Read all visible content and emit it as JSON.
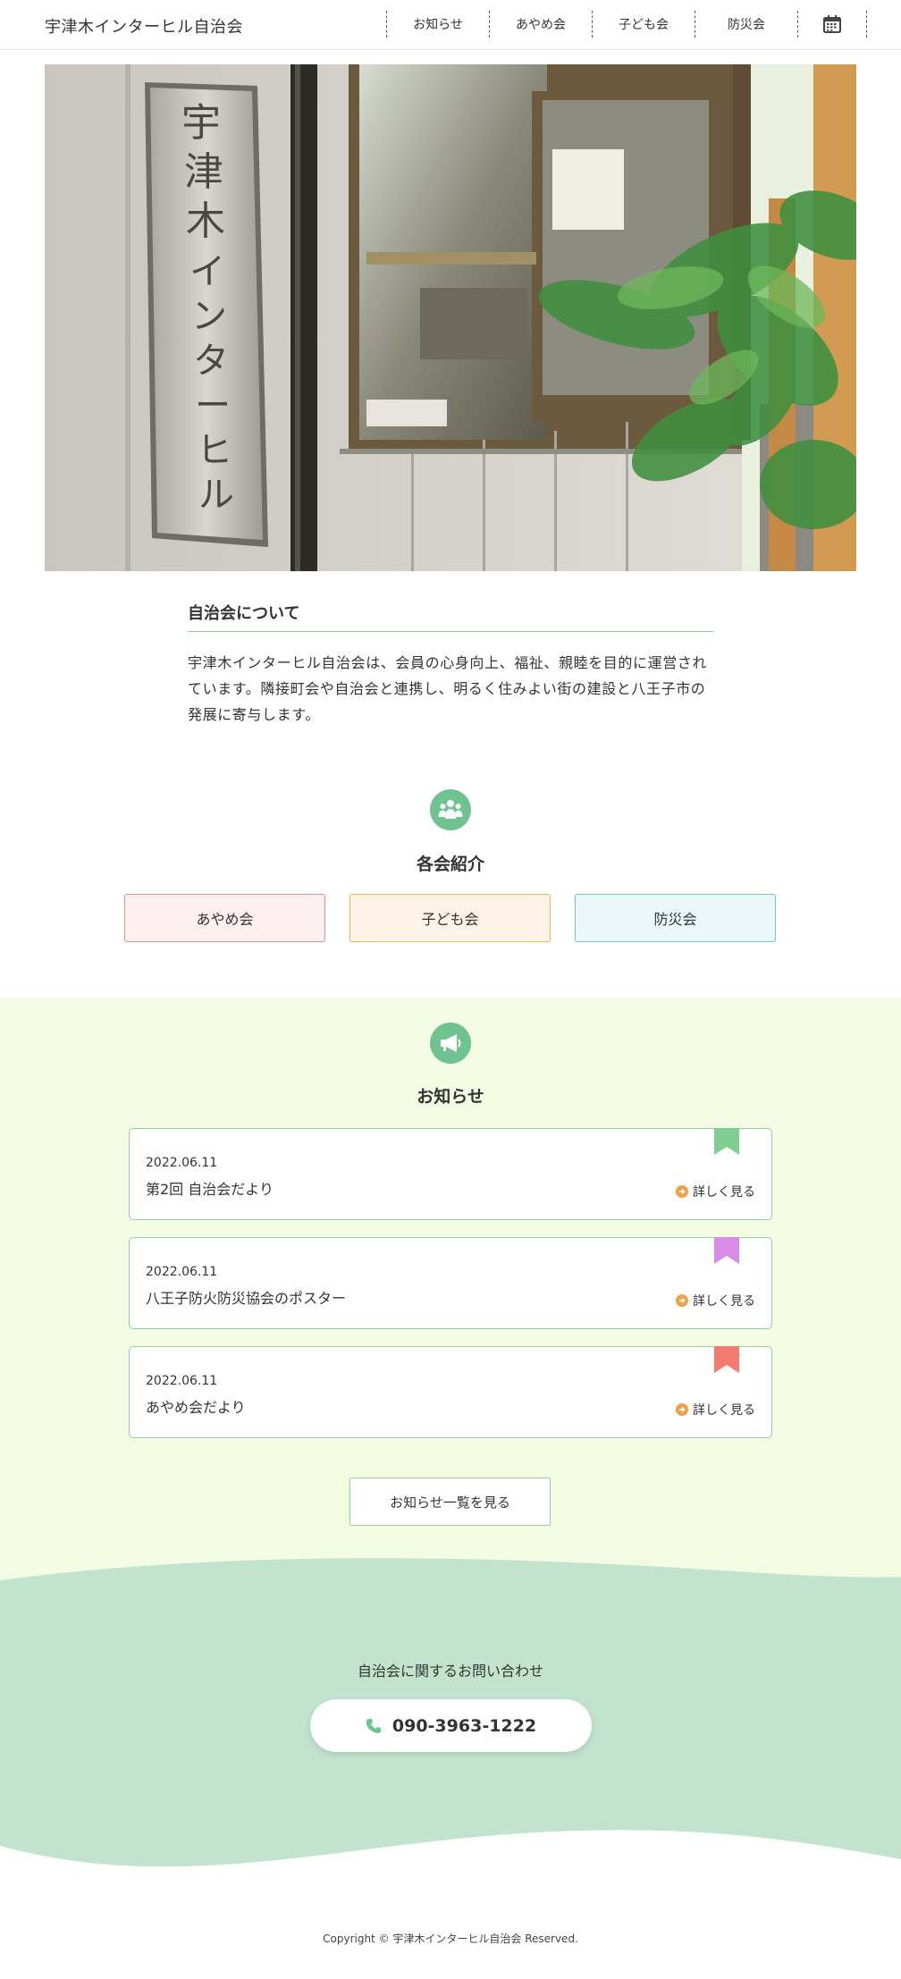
{
  "header": {
    "site_title": "宇津木インターヒル自治会",
    "nav": [
      "お知らせ",
      "あやめ会",
      "子ども会",
      "防災会"
    ],
    "calendar_icon": "calendar-icon"
  },
  "hero": {
    "sign_text": "宇津木インターヒル自治会事務所"
  },
  "about": {
    "title": "自治会について",
    "text": "宇津木インターヒル自治会は、会員の心身向上、福祉、親睦を目的に運営されています。隣接町会や自治会と連携し、明るく住みよい街の建設と八王子市の発展に寄与します。"
  },
  "groups": {
    "icon": "people-icon",
    "title": "各会紹介",
    "items": [
      "あやめ会",
      "子ども会",
      "防災会"
    ]
  },
  "news": {
    "icon": "megaphone-icon",
    "title": "お知らせ",
    "items": [
      {
        "date": "2022.06.11",
        "title": "第2回 自治会だより",
        "more": "詳しく見る",
        "ribbon_color": "#7fcf92"
      },
      {
        "date": "2022.06.11",
        "title": "八王子防火防災協会のポスター",
        "more": "詳しく見る",
        "ribbon_color": "#d98be8"
      },
      {
        "date": "2022.06.11",
        "title": "あやめ会だより",
        "more": "詳しく見る",
        "ribbon_color": "#f47a6e"
      }
    ],
    "all_button": "お知らせ一覧を見る"
  },
  "contact": {
    "label": "自治会に関するお問い合わせ",
    "phone": "090-3963-1222",
    "phone_icon": "phone-icon"
  },
  "footer": {
    "copyright": "Copyright © 宇津木インターヒル自治会 Reserved."
  },
  "colors": {
    "accent_green": "#6fc391",
    "news_bg": "#f3fbe3",
    "contact_bg": "#c2e4cf",
    "more_arrow": "#f0a04b"
  }
}
